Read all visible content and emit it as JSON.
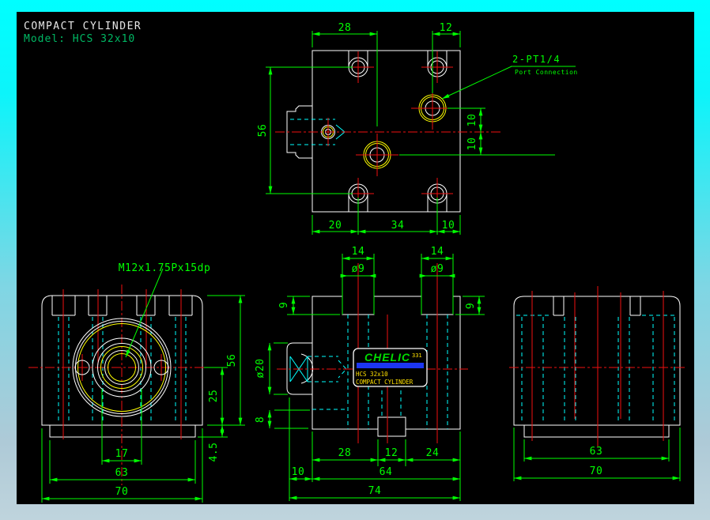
{
  "colors": {
    "border_top": "#00ffff",
    "border_bottom": "#bfd4dd",
    "canvas": "#000000",
    "geometry": "#ffffff",
    "dimension": "#00ff00",
    "centerline": "#ef1010",
    "hidden": "#00ffff",
    "feature": "#ffff00",
    "nameplate_stripe": "#1c36f2",
    "model_text": "#00b864"
  },
  "title_block": {
    "title": "COMPACT CYLINDER",
    "model": "Model: HCS 32x10"
  },
  "annotations": {
    "port_callout_title": "2-PT1/4",
    "port_callout_sub": "Port Connection",
    "thread_callout": "M12x1.75Px15dp"
  },
  "nameplate": {
    "brand": "CHELIC",
    "code": "331",
    "model": "HCS 32x10",
    "product": "COMPACT CYLINDER"
  },
  "dimensions": {
    "top_view": {
      "pitch_left": "28",
      "edge_right": "12",
      "vertical": "56",
      "upper_offset": "10",
      "lower_offset": "10",
      "bottom_a": "20",
      "bottom_b": "34",
      "bottom_c": "10"
    },
    "front_view": {
      "boss": "17",
      "base_width": "63",
      "overall_width": "70",
      "height": "56",
      "center_height": "25",
      "base_height": "4.5"
    },
    "side_view": {
      "cb_width_left": "14",
      "cb_width_right": "14",
      "cb_dia_left": "ø9",
      "cb_dia_right": "ø9",
      "cb_depth_left": "9",
      "cb_depth_right": "9",
      "port_dia": "ø20",
      "port_height": "8",
      "seg_a": "28",
      "seg_b": "12",
      "seg_c": "24",
      "boss_depth": "10",
      "body_width": "64",
      "overall_width": "74"
    },
    "rear_view": {
      "base_width": "63",
      "overall_width": "70"
    }
  }
}
